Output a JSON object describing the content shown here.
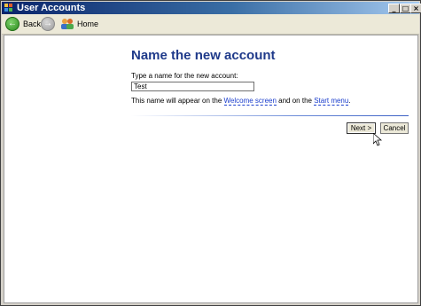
{
  "window": {
    "title": "User Accounts",
    "controls": {
      "minimize": "_",
      "maximize": "□",
      "close": "×"
    }
  },
  "toolbar": {
    "back_label": "Back",
    "home_label": "Home",
    "icons": {
      "back": "back-arrow-icon",
      "forward": "forward-arrow-icon",
      "home": "user-accounts-home-icon"
    }
  },
  "wizard": {
    "heading": "Name the new account",
    "field_label": "Type a name for the new account:",
    "name_value": "Test",
    "info_prefix": "This name will appear on the ",
    "welcome_link": "Welcome screen",
    "info_middle": " and on the ",
    "start_link": "Start menu",
    "info_suffix": ".",
    "next_label": "Next >",
    "cancel_label": "Cancel"
  },
  "colors": {
    "heading": "#1f3a8a",
    "link": "#1a3dcc",
    "titlebar": "#0a246a"
  }
}
